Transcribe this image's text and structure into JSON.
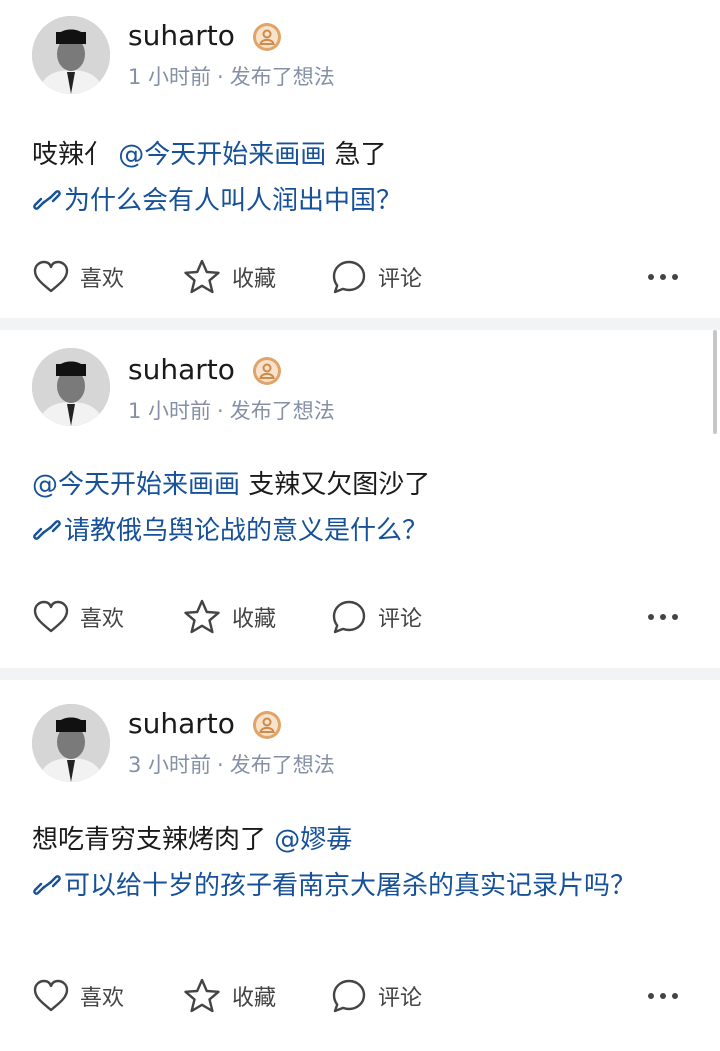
{
  "posts": [
    {
      "user": "suharto",
      "time": "1 小时前",
      "sep": "·",
      "action": "发布了想法",
      "text_before": "吱辣亻 ",
      "mention": "@今天开始来画画",
      "text_after": " 急了",
      "link": "为什么会有人叫人润出中国？",
      "like": "喜欢",
      "fav": "收藏",
      "comment": "评论"
    },
    {
      "user": "suharto",
      "time": "1 小时前",
      "sep": "·",
      "action": "发布了想法",
      "text_before": "",
      "mention": "@今天开始来画画",
      "text_after": " 支辣又欠图沙了",
      "link": "请教俄乌舆论战的意义是什么？",
      "like": "喜欢",
      "fav": "收藏",
      "comment": "评论"
    },
    {
      "user": "suharto",
      "time": "3 小时前",
      "sep": "·",
      "action": "发布了想法",
      "text_before": "想吃青穷支辣烤肉了 ",
      "mention": "@嫪毐",
      "text_after": "",
      "link": "可以给十岁的孩子看南京大屠杀的真实记录片吗？",
      "like": "喜欢",
      "fav": "收藏",
      "comment": "评论"
    }
  ],
  "icons": {
    "badge": "person-badge-icon",
    "link": "link-icon",
    "like": "heart-icon",
    "fav": "star-icon",
    "comment": "comment-bubble-icon",
    "more": "more-dots-icon"
  },
  "colors": {
    "link": "#175199",
    "meta": "#8590a6",
    "badge": "#e0a46a",
    "background": "#f2f3f5"
  }
}
